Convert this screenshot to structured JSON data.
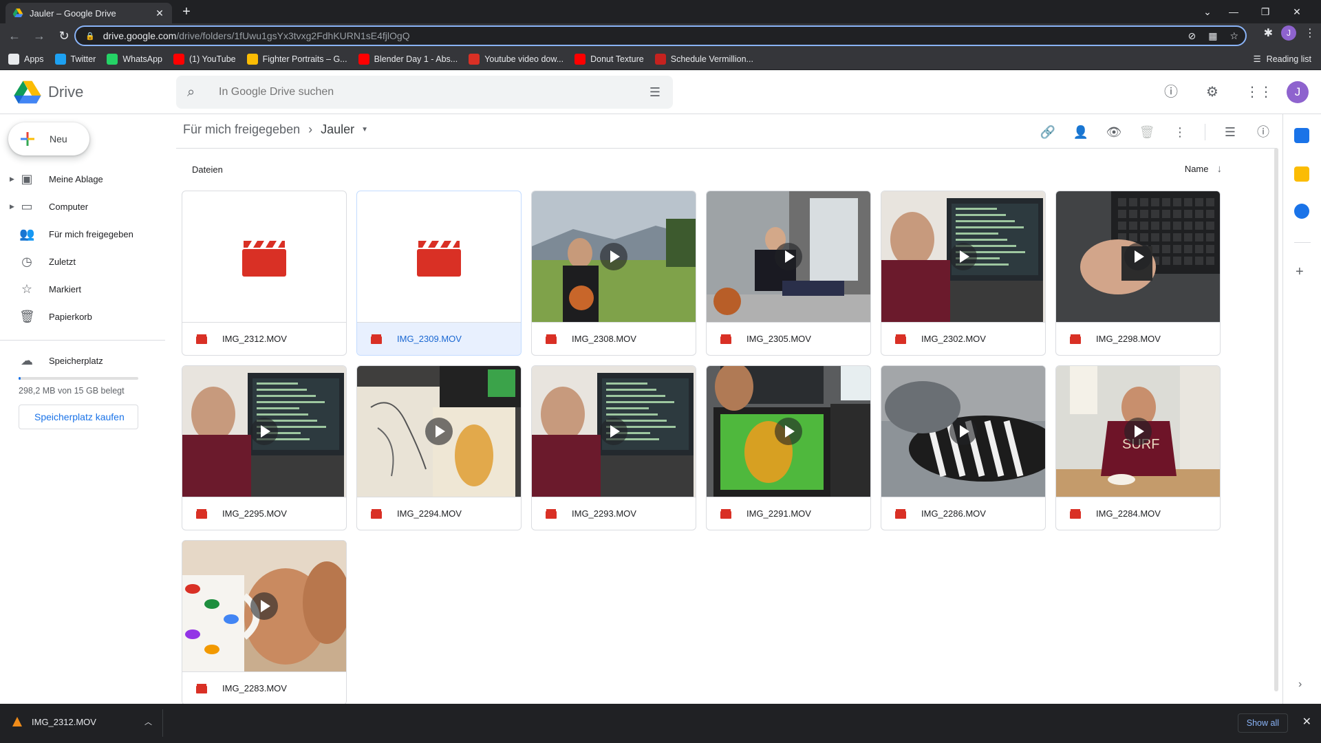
{
  "browser": {
    "tab_title": "Jauler – Google Drive",
    "url_host": "drive.google.com",
    "url_path": "/drive/folders/1fUwu1gsYx3tvxg2FdhKURN1sE4fjlOgQ",
    "bookmarks": [
      {
        "label": "Apps",
        "color": "#e8eaed"
      },
      {
        "label": "Twitter",
        "color": "#1da1f2"
      },
      {
        "label": "WhatsApp",
        "color": "#25d366"
      },
      {
        "label": "(1) YouTube",
        "color": "#ff0000"
      },
      {
        "label": "Fighter Portraits – G...",
        "color": "#fbbc04"
      },
      {
        "label": "Blender Day 1 - Abs...",
        "color": "#ff0000"
      },
      {
        "label": "Youtube video dow...",
        "color": "#d93025"
      },
      {
        "label": "Donut Texture",
        "color": "#ff0000"
      },
      {
        "label": "Schedule Vermillion...",
        "color": "#c5221f"
      }
    ],
    "reading_list": "Reading list",
    "profile_initial": "J"
  },
  "drive": {
    "product_name": "Drive",
    "search_placeholder": "In Google Drive suchen",
    "avatar_initial": "J",
    "new_label": "Neu",
    "nav": [
      {
        "label": "Meine Ablage",
        "icon": "my-drive-icon",
        "glyph": "▣",
        "caret": true
      },
      {
        "label": "Computer",
        "icon": "computer-icon",
        "glyph": "▭",
        "caret": true
      },
      {
        "label": "Für mich freigegeben",
        "icon": "shared-icon",
        "glyph": "👥",
        "caret": false
      },
      {
        "label": "Zuletzt",
        "icon": "clock-icon",
        "glyph": "◷",
        "caret": false
      },
      {
        "label": "Markiert",
        "icon": "star-icon",
        "glyph": "☆",
        "caret": false
      },
      {
        "label": "Papierkorb",
        "icon": "trash-icon",
        "glyph": "🗑",
        "caret": false
      }
    ],
    "storage": {
      "label": "Speicherplatz",
      "used_text": "298,2 MB von 15 GB belegt",
      "fraction": 0.02,
      "buy_label": "Speicherplatz kaufen"
    },
    "breadcrumb": {
      "parent": "Für mich freigegeben",
      "current": "Jauler"
    },
    "section_title": "Dateien",
    "sort_label": "Name",
    "files": [
      {
        "name": "IMG_2312.MOV",
        "thumb": "none",
        "selected": false
      },
      {
        "name": "IMG_2309.MOV",
        "thumb": "none",
        "selected": true
      },
      {
        "name": "IMG_2308.MOV",
        "thumb": "field",
        "selected": false
      },
      {
        "name": "IMG_2305.MOV",
        "thumb": "stairs",
        "selected": false
      },
      {
        "name": "IMG_2302.MOV",
        "thumb": "desk",
        "selected": false
      },
      {
        "name": "IMG_2298.MOV",
        "thumb": "keyboard",
        "selected": false
      },
      {
        "name": "IMG_2295.MOV",
        "thumb": "desk",
        "selected": false
      },
      {
        "name": "IMG_2294.MOV",
        "thumb": "sketch",
        "selected": false
      },
      {
        "name": "IMG_2293.MOV",
        "thumb": "desk",
        "selected": false
      },
      {
        "name": "IMG_2291.MOV",
        "thumb": "tablet",
        "selected": false
      },
      {
        "name": "IMG_2286.MOV",
        "thumb": "slippers",
        "selected": false
      },
      {
        "name": "IMG_2284.MOV",
        "thumb": "table",
        "selected": false
      },
      {
        "name": "IMG_2283.MOV",
        "thumb": "mug",
        "selected": false
      }
    ]
  },
  "download_bar": {
    "file": "IMG_2312.MOV",
    "show_all": "Show all"
  },
  "colors": {
    "accent": "#1a73e8",
    "video_red": "#d93025"
  }
}
